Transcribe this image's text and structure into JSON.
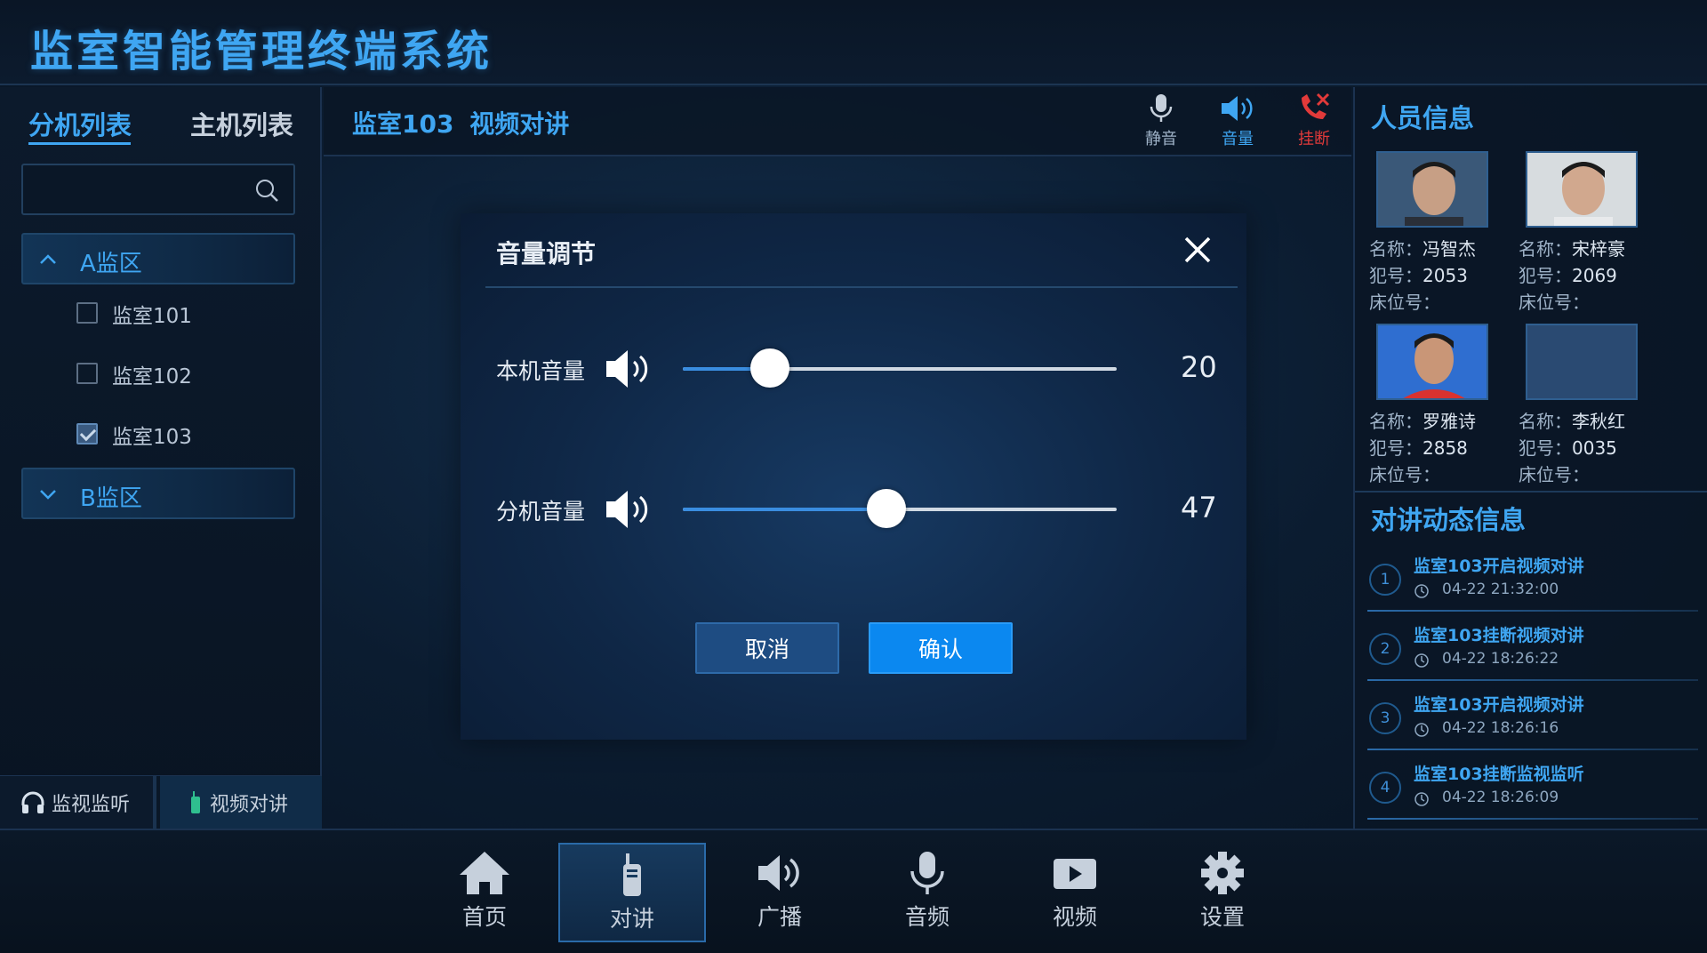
{
  "app": {
    "title": "监室智能管理终端系统"
  },
  "left": {
    "tabs": [
      {
        "label": "分机列表",
        "active": true
      },
      {
        "label": "主机列表",
        "active": false
      }
    ],
    "search": {
      "value": "",
      "placeholder": ""
    },
    "groups": [
      {
        "label": "A监区",
        "expanded": true,
        "rooms": [
          {
            "name": "监室101",
            "checked": false
          },
          {
            "name": "监室102",
            "checked": false
          },
          {
            "name": "监室103",
            "checked": true
          }
        ]
      },
      {
        "label": "B监区",
        "expanded": false
      }
    ],
    "bottom_buttons": [
      {
        "label": "监视监听",
        "icon": "headphones-icon"
      },
      {
        "label": "视频对讲",
        "icon": "walkie-talkie-icon"
      }
    ]
  },
  "center": {
    "title": "监室103  视频对讲",
    "tools": [
      {
        "label": "静音",
        "icon": "microphone-icon"
      },
      {
        "label": "音量",
        "icon": "speaker-icon"
      },
      {
        "label": "挂断",
        "icon": "hangup-icon"
      }
    ]
  },
  "modal": {
    "title": "音量调节",
    "rows": [
      {
        "label": "本机音量",
        "value": 20,
        "max": 100
      },
      {
        "label": "分机音量",
        "value": 47,
        "max": 100
      }
    ],
    "cancel": "取消",
    "confirm": "确认"
  },
  "right": {
    "people_title": "人员信息",
    "people": [
      {
        "name_label": "名称：",
        "name": "冯智杰",
        "id_label": "犯号：",
        "id": "2053",
        "bed_label": "床位号：",
        "bed": ""
      },
      {
        "name_label": "名称：",
        "name": "宋梓豪",
        "id_label": "犯号：",
        "id": "2069",
        "bed_label": "床位号：",
        "bed": ""
      },
      {
        "name_label": "名称：",
        "name": "罗雅诗",
        "id_label": "犯号：",
        "id": "2858",
        "bed_label": "床位号：",
        "bed": ""
      },
      {
        "name_label": "名称：",
        "name": "李秋红",
        "id_label": "犯号：",
        "id": "0035",
        "bed_label": "床位号：",
        "bed": ""
      }
    ],
    "events_title": "对讲动态信息",
    "events": [
      {
        "num": "1",
        "title": "监室103开启视频对讲",
        "time": "04-22 21:32:00"
      },
      {
        "num": "2",
        "title": "监室103挂断视频对讲",
        "time": "04-22 18:26:22"
      },
      {
        "num": "3",
        "title": "监室103开启视频对讲",
        "time": "04-22 18:26:16"
      },
      {
        "num": "4",
        "title": "监室103挂断监视监听",
        "time": "04-22 18:26:09"
      }
    ]
  },
  "nav": [
    {
      "label": "首页",
      "icon": "home-icon",
      "active": false
    },
    {
      "label": "对讲",
      "icon": "walkie-talkie-icon",
      "active": true
    },
    {
      "label": "广播",
      "icon": "speaker-icon",
      "active": false
    },
    {
      "label": "音频",
      "icon": "microphone-icon",
      "active": false
    },
    {
      "label": "视频",
      "icon": "video-camera-icon",
      "active": false
    },
    {
      "label": "设置",
      "icon": "gear-icon",
      "active": false
    }
  ],
  "colors": {
    "accent": "#3fa6f2",
    "confirm": "#0b88f0",
    "hangup": "#e23a3a",
    "panel": "#0a1626"
  }
}
